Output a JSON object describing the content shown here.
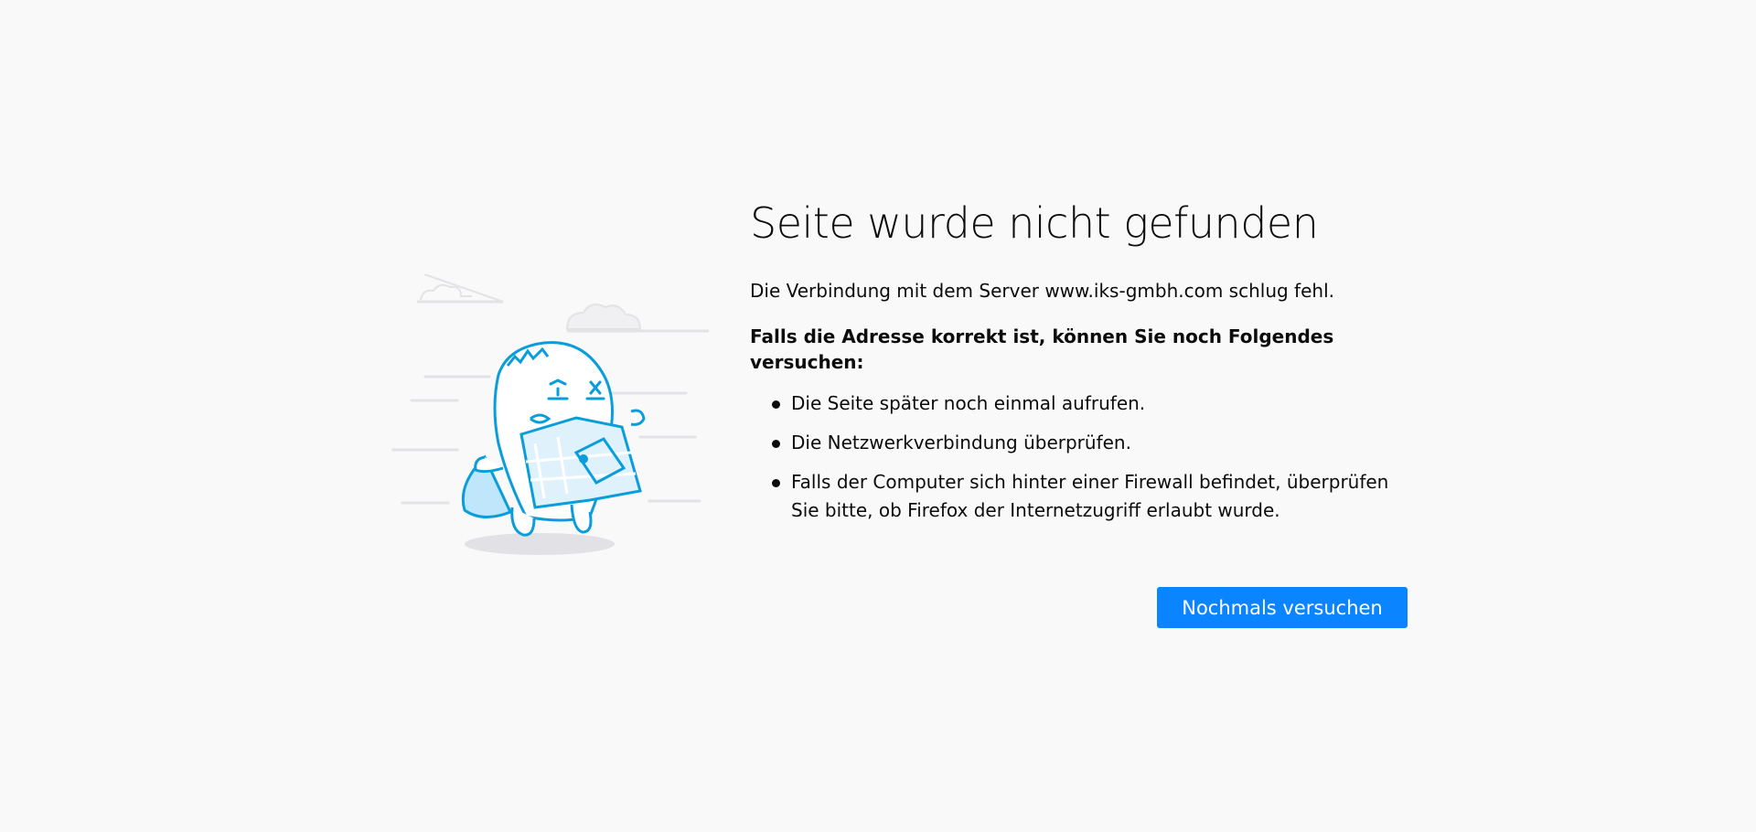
{
  "error": {
    "title": "Seite wurde nicht gefunden",
    "description": "Die Verbindung mit dem Server www.iks-gmbh.com schlug fehl.",
    "hint": "Falls die Adresse korrekt ist, können Sie noch Folgendes versuchen:",
    "suggestions": [
      "Die Seite später noch einmal aufrufen.",
      "Die Netzwerkverbindung überprüfen.",
      "Falls der Computer sich hinter einer Firewall befindet, überprüfen Sie bitte, ob Firefox der Internetzugriff erlaubt wurde."
    ],
    "retry_label": "Nochmals versuchen"
  },
  "colors": {
    "background": "#f9f9fa",
    "accent": "#0a84ff",
    "illustration": "#0a9ddb"
  },
  "illustration": {
    "icon": "lost-monster-with-map-illustration"
  }
}
